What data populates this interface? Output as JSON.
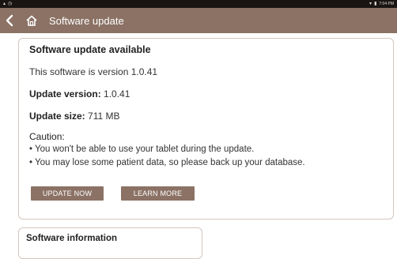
{
  "status_bar": {
    "time": "7:04 PM",
    "left_icons": [
      "android-debug-icon",
      "sync-icon"
    ],
    "right_icons": [
      "wifi-icon",
      "battery-icon"
    ]
  },
  "app_bar": {
    "title": "Software update",
    "background": "#8b7265"
  },
  "update_card": {
    "title": "Software update available",
    "version_line": "This software is version 1.0.41",
    "update_version_label": "Update version:",
    "update_version_value": "1.0.41",
    "update_size_label": "Update size:",
    "update_size_value": "711 MB",
    "caution_title": "Caution:",
    "caution_items": [
      "• You won't be able to use your tablet during the update.",
      "• You may lose some patient data, so please back up your database."
    ],
    "buttons": {
      "update_now": "UPDATE NOW",
      "learn_more": "LEARN MORE"
    }
  },
  "info_card": {
    "title": "Software information"
  },
  "colors": {
    "accent": "#8b7265",
    "status_bar": "#1a1512",
    "card_border": "#d4c6bf"
  }
}
